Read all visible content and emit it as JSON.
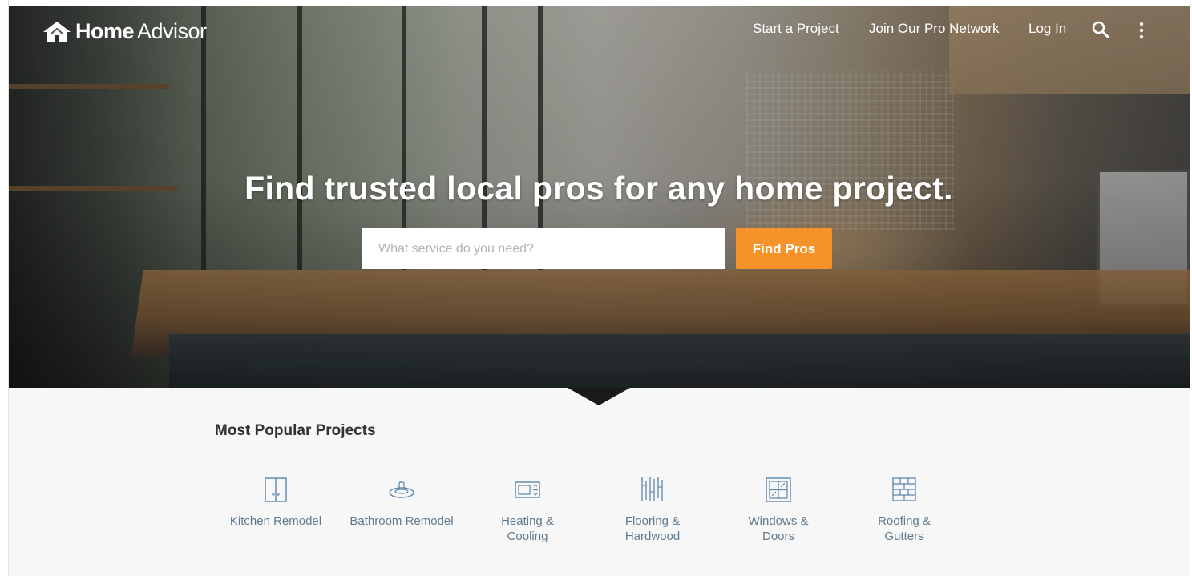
{
  "header": {
    "logo": {
      "bold": "Home",
      "light": "Advisor",
      "icon": "house-icon"
    },
    "nav": [
      {
        "label": "Start a Project"
      },
      {
        "label": "Join Our Pro Network"
      },
      {
        "label": "Log In"
      }
    ],
    "search_icon": "search-icon",
    "menu_icon": "vertical-dots-icon"
  },
  "hero": {
    "title": "Find trusted local pros for any home project.",
    "search_placeholder": "What service do you need?",
    "search_button": "Find Pros"
  },
  "popular": {
    "title": "Most Popular Projects",
    "items": [
      {
        "label": "Kitchen Remodel",
        "icon": "kitchen-cabinet-icon"
      },
      {
        "label": "Bathroom Remodel",
        "icon": "bathtub-icon"
      },
      {
        "label": "Heating & Cooling",
        "line1": "Heating &",
        "line2": "Cooling",
        "icon": "thermostat-icon"
      },
      {
        "label": "Flooring & Hardwood",
        "line1": "Flooring &",
        "line2": "Hardwood",
        "icon": "flooring-icon"
      },
      {
        "label": "Windows & Doors",
        "line1": "Windows &",
        "line2": "Doors",
        "icon": "window-icon"
      },
      {
        "label": "Roofing & Gutters",
        "line1": "Roofing &",
        "line2": "Gutters",
        "icon": "brick-icon"
      }
    ]
  },
  "colors": {
    "accent": "#f6922a",
    "project_text": "#5f7a8e",
    "icon_stroke": "#5b86ad",
    "section_bg": "#f7f7f7"
  }
}
